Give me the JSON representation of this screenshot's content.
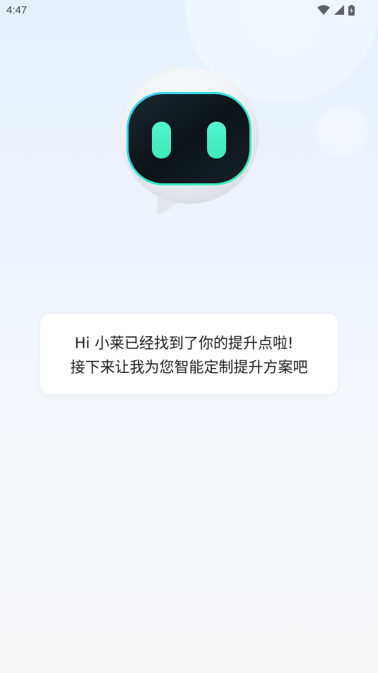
{
  "status_bar": {
    "time": "4:47",
    "icons": [
      "wifi-icon",
      "cellular-signal-icon",
      "battery-charging-icon"
    ]
  },
  "assistant": {
    "avatar_icon": "robot-assistant-icon",
    "message": {
      "line1": "Hi 小莱已经找到了你的提升点啦!",
      "line2": "接下来让我为您智能定制提升方案吧"
    }
  },
  "colors": {
    "accent_eyes": "#44f0c0",
    "face_screen": "#0d1a1e",
    "background_top": "#e6f0fd",
    "background_bottom": "#f8f8f9"
  }
}
